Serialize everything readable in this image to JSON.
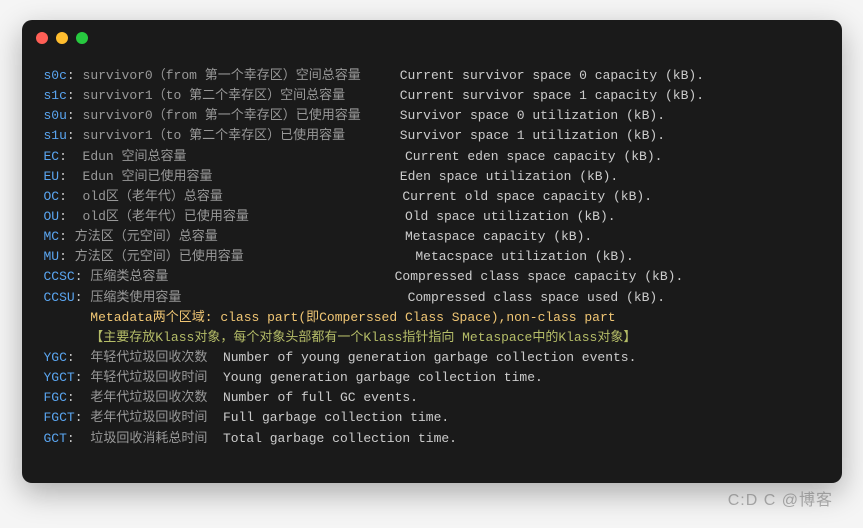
{
  "rows": [
    {
      "key": "s0c",
      "c": ": ",
      "v": "survivor0（from 第一个幸存区）空间总容量",
      "pad": "     ",
      "d": "Current survivor space 0 capacity (kB)."
    },
    {
      "key": "s1c",
      "c": ": ",
      "v": "survivor1（to 第二个幸存区）空间总容量",
      "pad": "       ",
      "d": "Current survivor space 1 capacity (kB)."
    },
    {
      "key": "s0u",
      "c": ": ",
      "v": "survivor0（from 第一个幸存区）已使用容量",
      "pad": "     ",
      "d": "Survivor space 0 utilization (kB)."
    },
    {
      "key": "s1u",
      "c": ": ",
      "v": "survivor1（to 第二个幸存区）已使用容量",
      "pad": "       ",
      "d": "Survivor space 1 utilization (kB)."
    },
    {
      "key": "EC",
      "c": ":  ",
      "v": "Edun 空间总容量",
      "pad": "                           ",
      "d": " Current eden space capacity (kB)."
    },
    {
      "key": "EU",
      "c": ":  ",
      "v": "Edun 空间已使用容量",
      "pad": "                        ",
      "d": "Eden space utilization (kB)."
    },
    {
      "key": "OC",
      "c": ":  ",
      "v": "old区（老年代）总容量",
      "pad": "                       ",
      "d": "Current old space capacity (kB)."
    },
    {
      "key": "OU",
      "c": ":  ",
      "v": "old区（老年代）已使用容量",
      "pad": "                    ",
      "d": "Old space utilization (kB)."
    },
    {
      "key": "MC",
      "c": ": ",
      "v": "方法区（元空间）总容量",
      "pad": "                        ",
      "d": "Metaspace capacity (kB)."
    },
    {
      "key": "MU",
      "c": ": ",
      "v": "方法区（元空间）已使用容量",
      "pad": "                     ",
      "d": " Metacspace utilization (kB)."
    },
    {
      "key": "CCSC",
      "c": ": ",
      "v": "压缩类总容量",
      "pad": "                             ",
      "d": "Compressed class space capacity (kB)."
    },
    {
      "key": "CCSU",
      "c": ": ",
      "v": "压缩类使用容量",
      "pad": "                            ",
      "d": " Compressed class space used (kB)."
    }
  ],
  "meta1": "      Metadata两个区域: class part(即Comperssed Class Space),non-class part",
  "meta2": "      【主要存放Klass对象，每个对象头部都有一个Klass指针指向 Metaspace中的Klass对象】",
  "rows2": [
    {
      "key": "YGC",
      "c": ":  ",
      "v": "年轻代垃圾回收次数",
      "pad": "  ",
      "d": "Number of young generation garbage collection events."
    },
    {
      "key": "YGCT",
      "c": ": ",
      "v": "年轻代垃圾回收时间",
      "pad": "  ",
      "d": "Young generation garbage collection time."
    },
    {
      "key": "FGC",
      "c": ":  ",
      "v": "老年代垃圾回收次数",
      "pad": "  ",
      "d": "Number of full GC events."
    },
    {
      "key": "FGCT",
      "c": ": ",
      "v": "老年代垃圾回收时间",
      "pad": "  ",
      "d": "Full garbage collection time."
    },
    {
      "key": "GCT",
      "c": ":  ",
      "v": "垃圾回收消耗总时间",
      "pad": "  ",
      "d": "Total garbage collection time."
    }
  ],
  "watermark": "C:D C @博客"
}
